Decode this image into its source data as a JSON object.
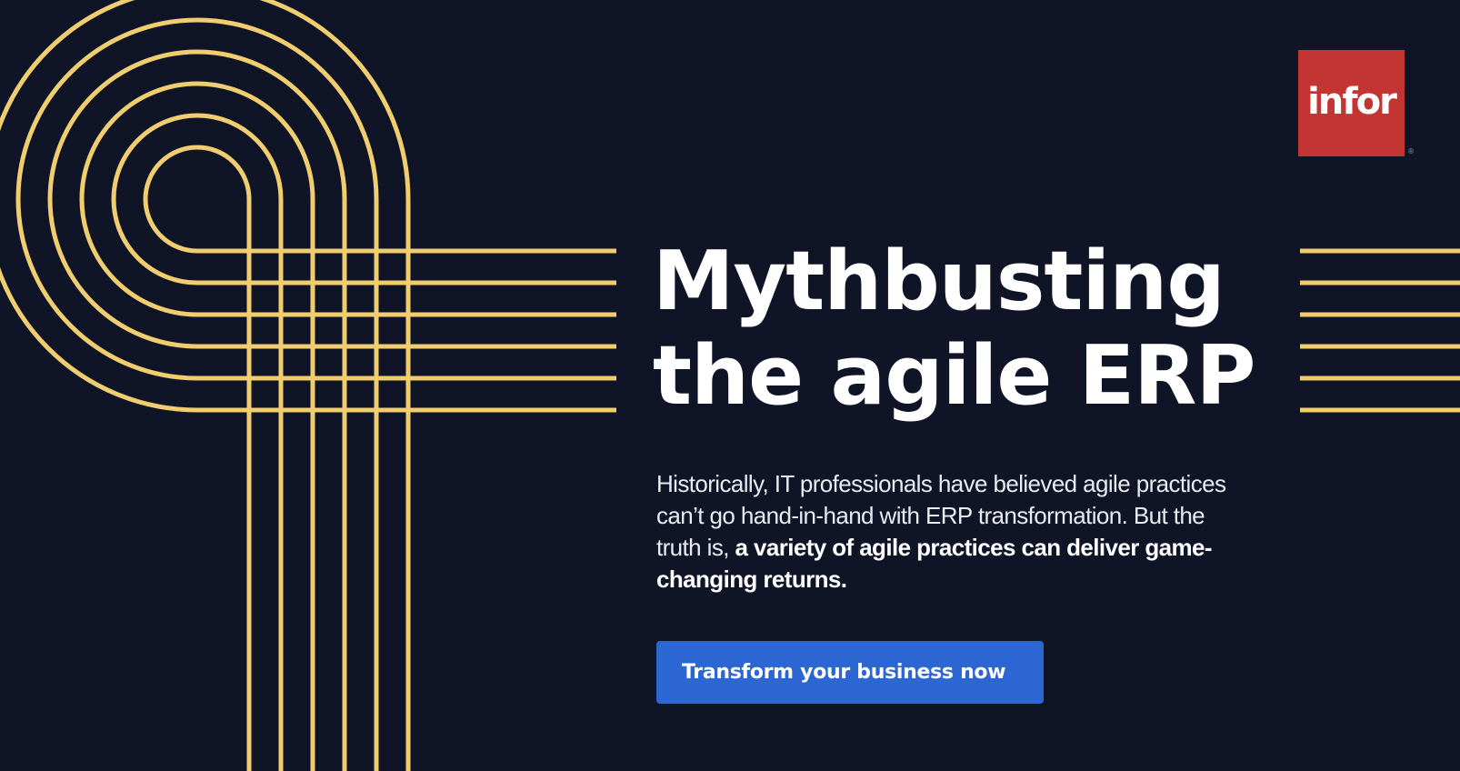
{
  "brand": {
    "logo_text": "infor",
    "registered_mark": "®",
    "logo_color": "#c33532"
  },
  "hero": {
    "headline_line1": "Mythbusting",
    "headline_line2": "the agile ERP",
    "body_light": "Historically, IT professionals have believed agile practices can’t go hand-in-hand with ERP transformation. But the truth is, ",
    "body_bold": "a variety of agile practices can deliver game-changing returns.",
    "cta_label": "Transform your business now"
  },
  "theme": {
    "background": "#0f1526",
    "line_color": "#f0cd6e",
    "cta_color": "#2b66d3",
    "text_color": "#ffffff"
  },
  "icons": {
    "left_decor": "concentric-lines-graphic",
    "right_decor": "horizontal-lines-graphic"
  }
}
